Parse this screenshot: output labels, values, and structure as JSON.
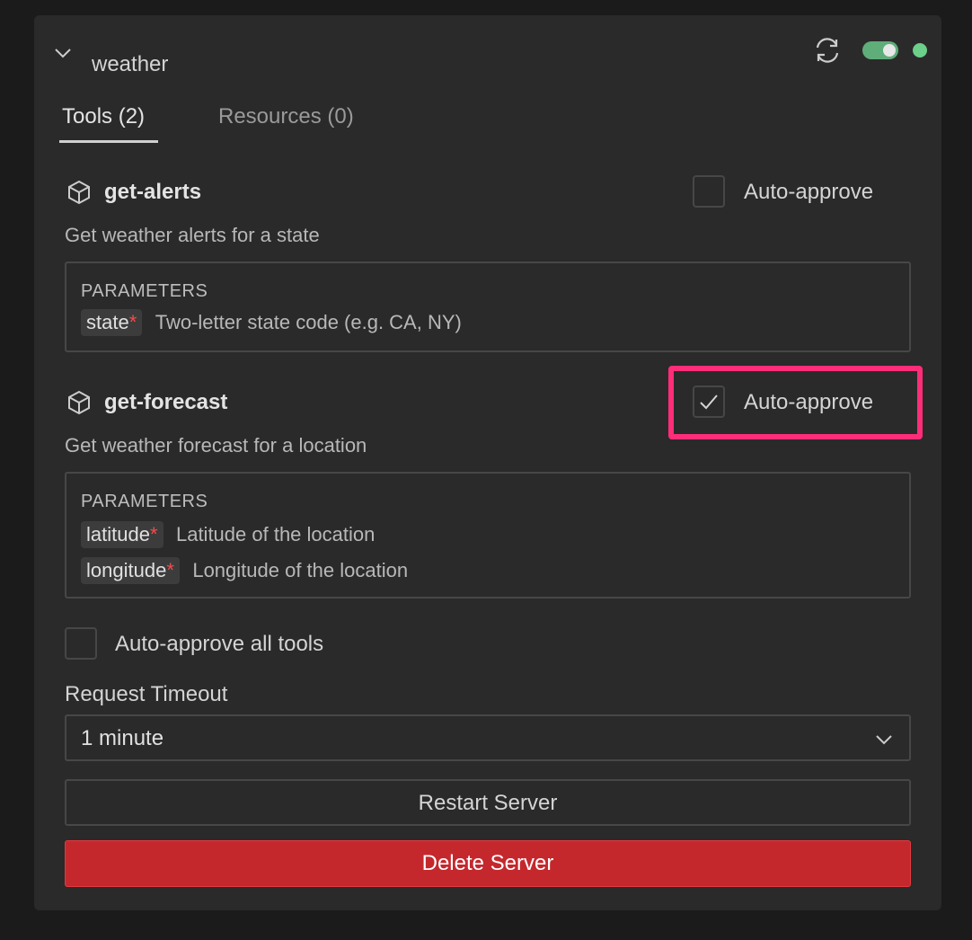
{
  "server": {
    "name": "weather",
    "enabled": true,
    "status_color": "#6ccf8a"
  },
  "tabs": [
    {
      "label": "Tools (2)",
      "active": true
    },
    {
      "label": "Resources (0)",
      "active": false
    }
  ],
  "tools": [
    {
      "icon": "cube-icon",
      "name": "get-alerts",
      "description": "Get weather alerts for a state",
      "auto_approve_label": "Auto-approve",
      "auto_approve": false,
      "parameters_heading": "PARAMETERS",
      "parameters": [
        {
          "name": "state",
          "required_mark": "*",
          "description": "Two-letter state code (e.g. CA, NY)"
        }
      ]
    },
    {
      "icon": "cube-icon",
      "name": "get-forecast",
      "description": "Get weather forecast for a location",
      "auto_approve_label": "Auto-approve",
      "auto_approve": true,
      "parameters_heading": "PARAMETERS",
      "parameters": [
        {
          "name": "latitude",
          "required_mark": "*",
          "description": "Latitude of the location"
        },
        {
          "name": "longitude",
          "required_mark": "*",
          "description": "Longitude of the location"
        }
      ]
    }
  ],
  "auto_approve_all": {
    "label": "Auto-approve all tools",
    "checked": false
  },
  "request_timeout": {
    "label": "Request Timeout",
    "value": "1 minute"
  },
  "buttons": {
    "restart": "Restart Server",
    "delete": "Delete Server"
  },
  "colors": {
    "accent_highlight": "#ff2d78",
    "delete_button": "#c4282d",
    "toggle_on": "#5fae7a",
    "required": "#f14c4c"
  }
}
